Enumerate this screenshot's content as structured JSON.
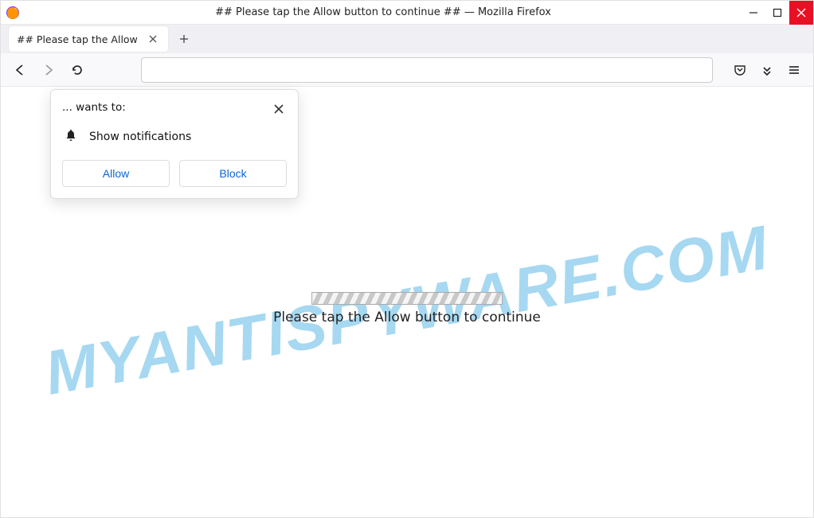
{
  "window": {
    "title": "## Please tap the Allow button to continue ## — Mozilla Firefox"
  },
  "tab": {
    "label": "## Please tap the Allow"
  },
  "urlbar": {
    "value": ""
  },
  "permission_popup": {
    "title": "... wants to:",
    "body": "Show notifications",
    "allow_label": "Allow",
    "block_label": "Block"
  },
  "page": {
    "message": "Please tap the Allow button to continue"
  },
  "watermark": {
    "text": "MYANTISPYWARE.COM"
  }
}
